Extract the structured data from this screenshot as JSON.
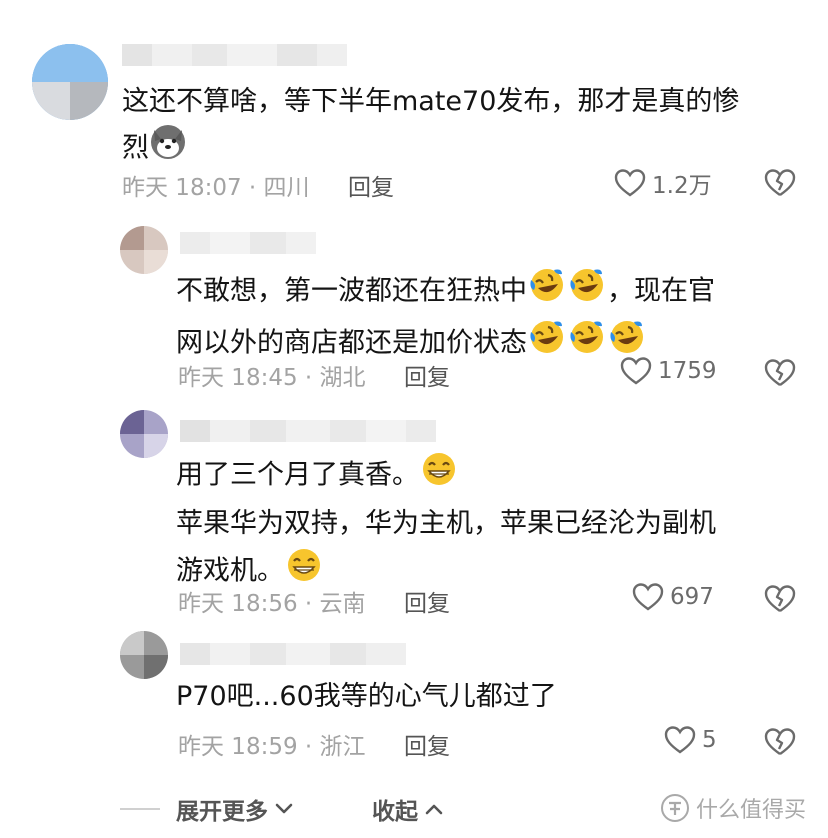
{
  "comments": [
    {
      "text": "这还不算啥，等下半年mate70发布，那才是真的惨",
      "text2": "烈",
      "time": "昨天 18:07 · 四川",
      "reply": "回复",
      "likes": "1.2万",
      "emoji": "husky-dog-emoji"
    },
    {
      "text": "不敢想，第一波都还在狂热中",
      "text_after": "，现在官",
      "text2": "网以外的商店都还是加价状态",
      "time": "昨天 18:45 · 湖北",
      "reply": "回复",
      "likes": "1759",
      "emoji": "rolling-on-floor-laughing-emoji"
    },
    {
      "text": "用了三个月了真香。",
      "text2": "苹果华为双持，华为主机，苹果已经沦为副机",
      "text3": "游戏机。",
      "time": "昨天 18:56 · 云南",
      "reply": "回复",
      "likes": "697",
      "emoji": "grinning-face-emoji"
    },
    {
      "text": "P70吧...60我等的心气儿都过了",
      "time": "昨天 18:59 · 浙江",
      "reply": "回复",
      "likes": "5"
    }
  ],
  "footer": {
    "expand_more": "展开更多",
    "collapse": "收起",
    "watermark": "什么值得买"
  },
  "colors": {
    "text": "#141414",
    "meta": "#a3a3a3",
    "laugh_yellow": "#f7c52d",
    "tear_blue": "#2f8fe8"
  }
}
